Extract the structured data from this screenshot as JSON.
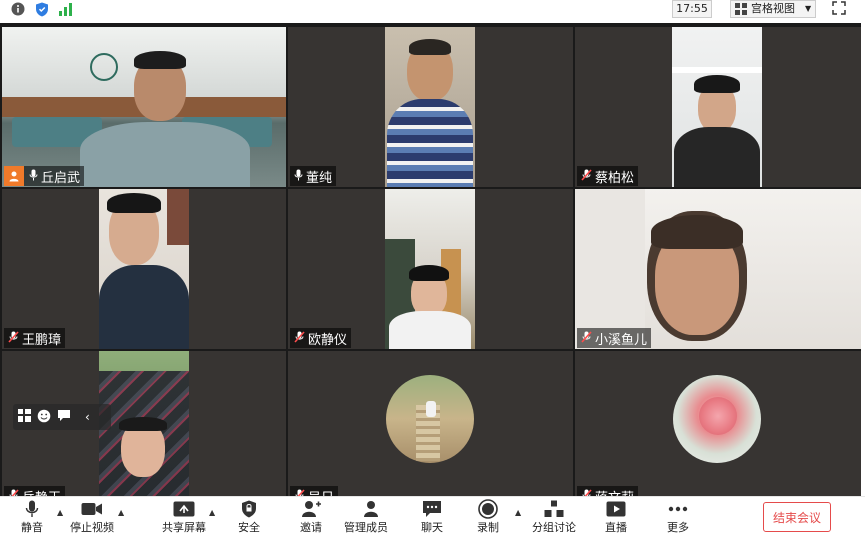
{
  "topbar": {
    "time": "17:55",
    "view_mode": "宫格视图"
  },
  "participants": [
    {
      "name": "丘启武",
      "mic": "on",
      "host": true
    },
    {
      "name": "董纯",
      "mic": "on",
      "host": false
    },
    {
      "name": "蔡柏松",
      "mic": "off",
      "host": false
    },
    {
      "name": "王鹏璋",
      "mic": "off",
      "host": false
    },
    {
      "name": "欧静仪",
      "mic": "off",
      "host": false
    },
    {
      "name": "小溪鱼儿",
      "mic": "off",
      "host": false
    },
    {
      "name": "岳静王",
      "mic": "off",
      "host": false
    },
    {
      "name": "吴日",
      "mic": "off",
      "host": false
    },
    {
      "name": "蒋文莉",
      "mic": "off",
      "host": false
    }
  ],
  "toolbar": {
    "mute": "静音",
    "stop_video": "停止视频",
    "share_screen": "共享屏幕",
    "security": "安全",
    "invite": "邀请",
    "manage_members": "管理成员(9)",
    "chat": "聊天",
    "record": "录制",
    "breakout": "分组讨论",
    "live": "直播",
    "more": "更多",
    "end_meeting": "结束会议"
  }
}
